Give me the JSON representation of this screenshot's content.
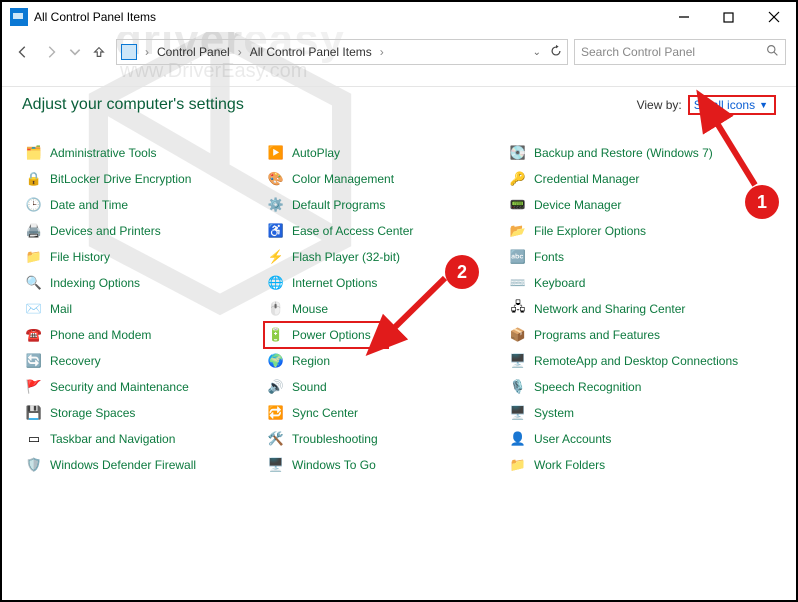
{
  "title": "All Control Panel Items",
  "breadcrumb": {
    "seg1": "Control Panel",
    "seg2": "All Control Panel Items"
  },
  "search_placeholder": "Search Control Panel",
  "heading": "Adjust your computer's settings",
  "viewby": {
    "label": "View by:",
    "value": "Small icons"
  },
  "watermark": {
    "big1": "driver",
    "big2": "easy",
    "sub": "www.DriverEasy.com"
  },
  "annotations": {
    "badge1": "1",
    "badge2": "2"
  },
  "col1": [
    {
      "label": "Administrative Tools",
      "icon": "🗂️"
    },
    {
      "label": "BitLocker Drive Encryption",
      "icon": "🔒"
    },
    {
      "label": "Date and Time",
      "icon": "🕒"
    },
    {
      "label": "Devices and Printers",
      "icon": "🖨️"
    },
    {
      "label": "File History",
      "icon": "📁"
    },
    {
      "label": "Indexing Options",
      "icon": "🔍"
    },
    {
      "label": "Mail",
      "icon": "✉️"
    },
    {
      "label": "Phone and Modem",
      "icon": "☎️"
    },
    {
      "label": "Recovery",
      "icon": "🔄"
    },
    {
      "label": "Security and Maintenance",
      "icon": "🚩"
    },
    {
      "label": "Storage Spaces",
      "icon": "💾"
    },
    {
      "label": "Taskbar and Navigation",
      "icon": "▭"
    },
    {
      "label": "Windows Defender Firewall",
      "icon": "🛡️"
    }
  ],
  "col2": [
    {
      "label": "AutoPlay",
      "icon": "▶️"
    },
    {
      "label": "Color Management",
      "icon": "🎨"
    },
    {
      "label": "Default Programs",
      "icon": "⚙️"
    },
    {
      "label": "Ease of Access Center",
      "icon": "♿"
    },
    {
      "label": "Flash Player (32-bit)",
      "icon": "⚡"
    },
    {
      "label": "Internet Options",
      "icon": "🌐"
    },
    {
      "label": "Mouse",
      "icon": "🖱️"
    },
    {
      "label": "Power Options",
      "icon": "🔋",
      "power": true
    },
    {
      "label": "Region",
      "icon": "🌍"
    },
    {
      "label": "Sound",
      "icon": "🔊"
    },
    {
      "label": "Sync Center",
      "icon": "🔁"
    },
    {
      "label": "Troubleshooting",
      "icon": "🛠️"
    },
    {
      "label": "Windows To Go",
      "icon": "🖥️"
    }
  ],
  "col3": [
    {
      "label": "Backup and Restore (Windows 7)",
      "icon": "💽"
    },
    {
      "label": "Credential Manager",
      "icon": "🔑"
    },
    {
      "label": "Device Manager",
      "icon": "📟"
    },
    {
      "label": "File Explorer Options",
      "icon": "📂"
    },
    {
      "label": "Fonts",
      "icon": "🔤"
    },
    {
      "label": "Keyboard",
      "icon": "⌨️"
    },
    {
      "label": "Network and Sharing Center",
      "icon": "🖧"
    },
    {
      "label": "Programs and Features",
      "icon": "📦"
    },
    {
      "label": "RemoteApp and Desktop Connections",
      "icon": "🖥️"
    },
    {
      "label": "Speech Recognition",
      "icon": "🎙️"
    },
    {
      "label": "System",
      "icon": "🖥️"
    },
    {
      "label": "User Accounts",
      "icon": "👤"
    },
    {
      "label": "Work Folders",
      "icon": "📁"
    }
  ]
}
